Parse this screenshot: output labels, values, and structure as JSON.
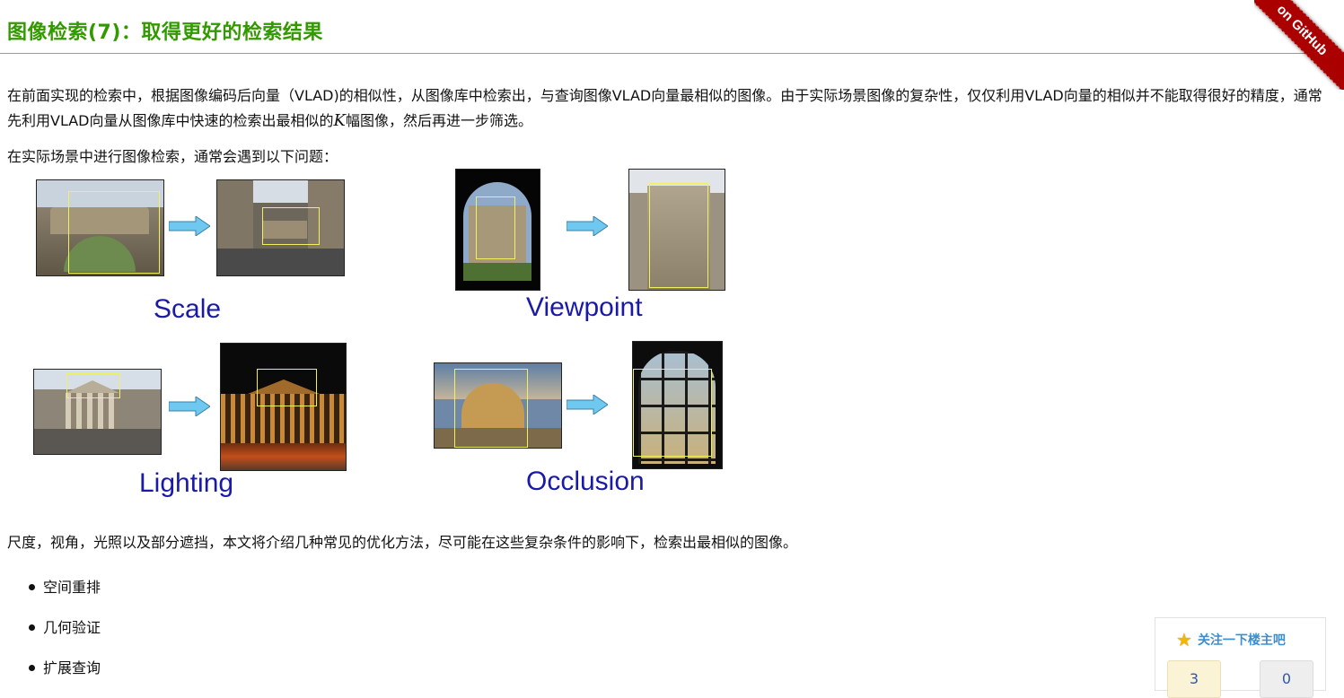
{
  "page": {
    "title": "图像检索(7)：取得更好的检索结果",
    "ribbon_label": "on GitHub"
  },
  "content": {
    "para1_a": "在前面实现的检索中，根据图像编码后向量（VLAD)的相似性，从图像库中检索出，与查询图像VLAD向量最相似的图像。由于实际场景图像的复杂性，仅仅利用VLAD向量的相似并不能取得很好的精度，通常先利用VLAD向量从图像库中快速的检索出最相似的",
    "para1_k": "K",
    "para1_b": "幅图像，然后再进一步筛选。",
    "para2": "在实际场景中进行图像检索，通常会遇到以下问题：",
    "para3": "尺度，视角，光照以及部分遮挡，本文将介绍几种常见的优化方法，尽可能在这些复杂条件的影响下，检索出最相似的图像。",
    "list": [
      "空间重排",
      "几何验证",
      "扩展查询"
    ]
  },
  "figure": {
    "labels": [
      "Scale",
      "Viewpoint",
      "Lighting",
      "Occlusion"
    ],
    "label_color": "#1a1aa6",
    "arrow_color": "#6ec8f0"
  },
  "widget": {
    "follow_label": "关注一下楼主吧",
    "up_count": "3",
    "down_count": "0"
  },
  "colors": {
    "title": "#339900",
    "ribbon": "#aa0000",
    "link": "#3a8fd0"
  }
}
